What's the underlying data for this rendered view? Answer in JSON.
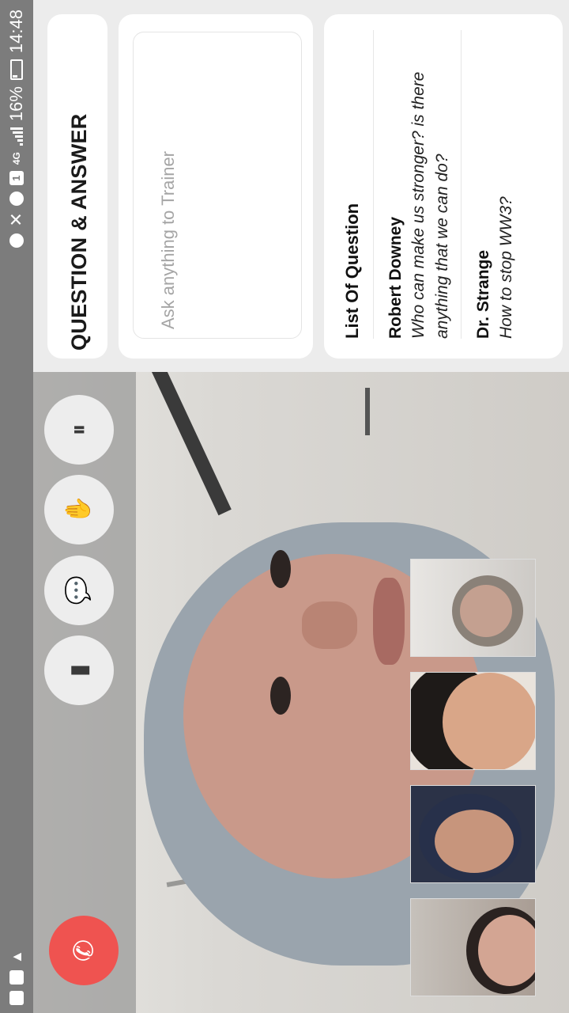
{
  "status_bar": {
    "time": "14:48",
    "battery": "16%",
    "sim_slot": "1",
    "network": "4G",
    "icons": [
      "gmail-icon",
      "gmail-icon",
      "warning-icon",
      "android-icon",
      "mute-icon",
      "alarm-icon",
      "sim-icon",
      "signal-icon",
      "battery-icon"
    ]
  },
  "qa_panel": {
    "title": "QUESTION & ANSWER",
    "input_placeholder": "Ask anything to Trainer",
    "list_title": "List Of Question",
    "questions": [
      {
        "name": "Robert Downey",
        "text": "Who can make us stronger? is there anything that we can do?"
      },
      {
        "name": "Dr. Strange",
        "text": "How to stop WW3?"
      }
    ]
  },
  "controls": {
    "buttons": [
      {
        "name": "switch-camera-button",
        "icon": "camera-pause-icon",
        "glyph": "⏸"
      },
      {
        "name": "raise-hand-button",
        "icon": "hand-icon",
        "glyph": "✋"
      },
      {
        "name": "chat-button",
        "icon": "chat-bubble-icon",
        "glyph": "💬"
      },
      {
        "name": "microphone-button",
        "icon": "mic-icon",
        "glyph": "▮"
      }
    ],
    "end_call": {
      "icon": "phone-icon",
      "glyph": "✆"
    }
  },
  "participants": [
    "participant-1",
    "participant-2",
    "participant-3",
    "participant-4"
  ],
  "colors": {
    "end_call": "#ef5350",
    "status_bar": "#7c7c7c",
    "card_bg": "#ffffff",
    "page_bg": "#ececec"
  }
}
